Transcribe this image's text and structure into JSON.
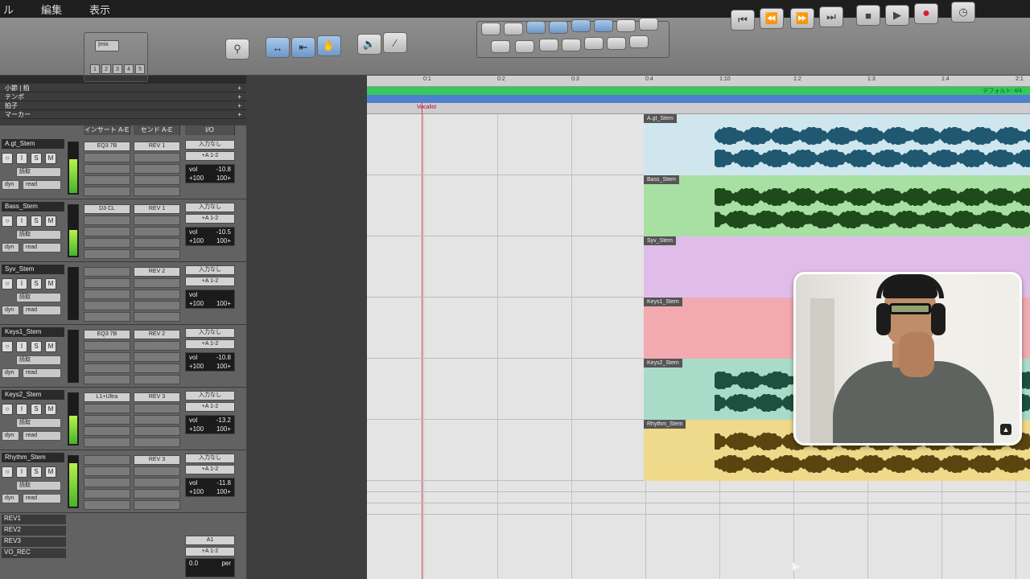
{
  "menubar": {
    "items": [
      "ル",
      "編集",
      "表示"
    ]
  },
  "controlbar": {
    "view_selector": "|mix",
    "transport": [
      "skip-back-icon",
      "rewind-icon",
      "fast-forward-icon",
      "skip-forward-icon",
      "stop-icon",
      "play-icon",
      "record-icon"
    ],
    "numbers": [
      "1",
      "2",
      "3",
      "4",
      "5"
    ]
  },
  "global_tracks": [
    {
      "label": "小節 | 拍",
      "add": "+"
    },
    {
      "label": "テンポ",
      "add": "+"
    },
    {
      "label": "拍子",
      "add": "+"
    },
    {
      "label": "マーカー",
      "add": "+"
    }
  ],
  "mixer": {
    "columns": [
      "インサート A-E",
      "センド A-E",
      "I/O"
    ],
    "buttons": {
      "power": "○",
      "input": "I",
      "solo": "S",
      "mute": "M"
    },
    "mode_label": "読取",
    "dyn_label": "dyn",
    "read_label": "read",
    "tracks": [
      {
        "name": "A.gt_Stem",
        "insert": "EQ3 7B",
        "send": "REV 1",
        "input": "入力なし",
        "output": "+A 1-2",
        "vol": "-10.8",
        "pan_l": "+100",
        "pan_r": "100+",
        "meter": 0.65
      },
      {
        "name": "Bass_Stem",
        "insert": "D3 CL",
        "send": "REV 1",
        "input": "入力なし",
        "output": "+A 1-2",
        "vol": "-10.5",
        "pan_l": "+100",
        "pan_r": "100+",
        "meter": 0.5
      },
      {
        "name": "Syv_Stem",
        "insert": "",
        "send": "REV 2",
        "input": "入力なし",
        "output": "+A 1-2",
        "vol": "",
        "pan_l": "+100",
        "pan_r": "100+",
        "meter": 0.0
      },
      {
        "name": "Keys1_Stem",
        "insert": "EQ3 7B",
        "send": "REV 2",
        "input": "入力なし",
        "output": "+A 1-2",
        "vol": "-10.8",
        "pan_l": "+100",
        "pan_r": "100+",
        "meter": 0.0
      },
      {
        "name": "Keys2_Stem",
        "insert": "L1+Ultra",
        "send": "REV 3",
        "input": "入力なし",
        "output": "+A 1-2",
        "vol": "-13.2",
        "pan_l": "+100",
        "pan_r": "100+",
        "meter": 0.55
      },
      {
        "name": "Rhythm_Stem",
        "insert": "",
        "send": "REV 3",
        "input": "入力なし",
        "output": "+A 1-2",
        "vol": "-11.8",
        "pan_l": "+100",
        "pan_r": "100+",
        "meter": 0.85
      }
    ],
    "returns": [
      "REV1",
      "REV2",
      "REV3",
      "VO_REC"
    ],
    "vo": {
      "output": "A1",
      "bus": "+A 1-2",
      "vol": "0.0",
      "pan": "per"
    }
  },
  "arrange": {
    "ruler": [
      "0:1",
      "0:2",
      "0:3",
      "0:4",
      "1:10",
      "1:2",
      "1:3",
      "1:4",
      "2:1"
    ],
    "tempo_label": "デフォルト: 4/4",
    "marker": "Vocalist",
    "regions": [
      {
        "name": "A.gt_Stem",
        "color": "#cfe6ef",
        "wave": "#1f5870"
      },
      {
        "name": "Bass_Stem",
        "color": "#a8e0a4",
        "wave": "#1f4a1a"
      },
      {
        "name": "Syv_Stem",
        "color": "#e0bde8",
        "wave": "#6a3070"
      },
      {
        "name": "Keys1_Stem",
        "color": "#f2a9b0",
        "wave": "#7a2030"
      },
      {
        "name": "Keys2_Stem",
        "color": "#a9dcc8",
        "wave": "#1d5040"
      },
      {
        "name": "Rhythm_Stem",
        "color": "#efd98a",
        "wave": "#5a4510"
      }
    ]
  },
  "webcam": {
    "logo": "▲"
  }
}
